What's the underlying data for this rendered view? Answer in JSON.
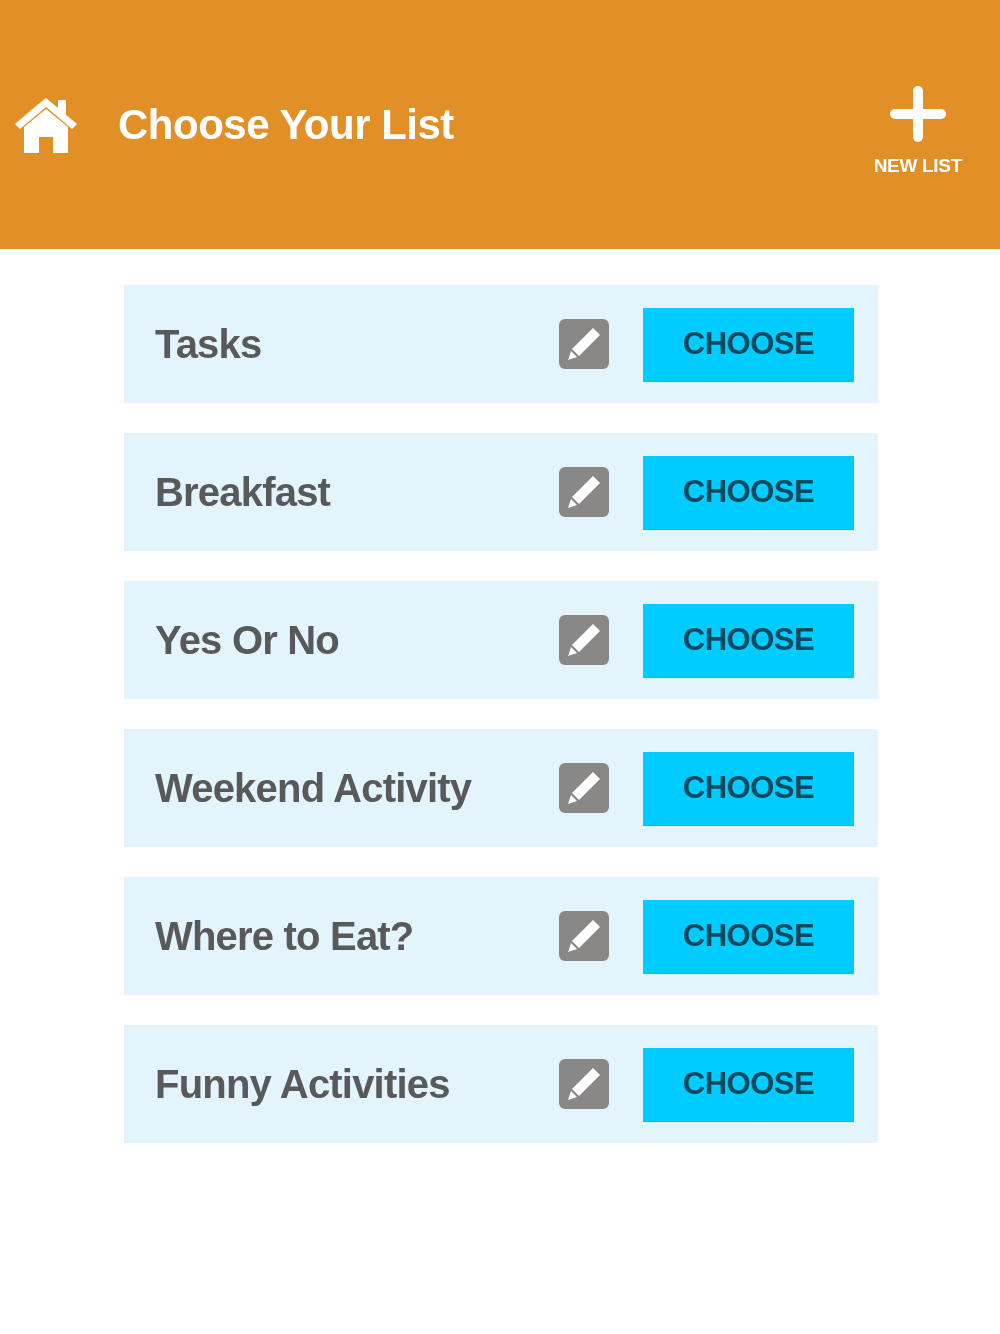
{
  "header": {
    "title": "Choose Your List",
    "new_list_label": "NEW LIST"
  },
  "lists": [
    {
      "name": "Tasks",
      "action": "CHOOSE"
    },
    {
      "name": "Breakfast",
      "action": "CHOOSE"
    },
    {
      "name": "Yes Or No",
      "action": "CHOOSE"
    },
    {
      "name": "Weekend Activity",
      "action": "CHOOSE"
    },
    {
      "name": "Where to Eat?",
      "action": "CHOOSE"
    },
    {
      "name": "Funny Activities",
      "action": "CHOOSE"
    }
  ]
}
